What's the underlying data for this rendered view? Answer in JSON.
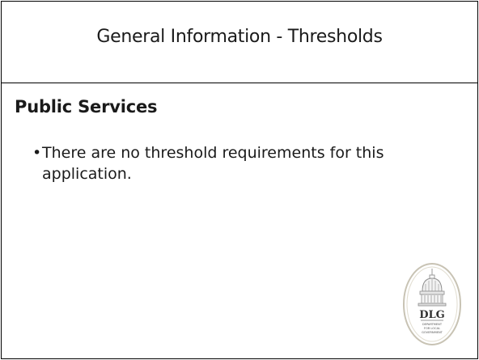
{
  "slide": {
    "title": "General Information - Thresholds",
    "heading": "Public Services",
    "bullets": [
      "There are no threshold requirements for this application."
    ],
    "bullet_glyph": "•"
  },
  "logo": {
    "icon": "dlg-seal-icon",
    "text": "DLG",
    "subtext": [
      "DEPARTMENT",
      "FOR LOCAL",
      "GOVERNMENT"
    ]
  }
}
